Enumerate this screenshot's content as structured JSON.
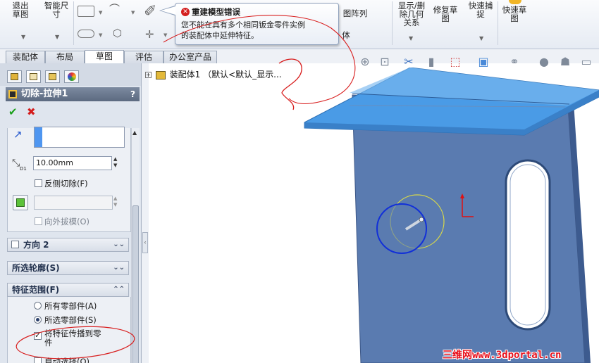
{
  "ribbon": {
    "exit_sketch": "退出草图",
    "smart_dim": "智能尺寸",
    "pattern_label": "图阵列",
    "body_label": "体",
    "display_delete": "显示/删除几何关系",
    "repair_sketch": "修复草图",
    "quick_snap": "快速捕捉",
    "rapid_sketch": "快速草图"
  },
  "tooltip": {
    "title": "重建模型错误",
    "line1": "您不能在具有多个相同钣金零件实例",
    "line2": "的装配体中延伸特征。"
  },
  "tabs": [
    {
      "label": "装配体"
    },
    {
      "label": "布局"
    },
    {
      "label": "草图"
    },
    {
      "label": "评估"
    },
    {
      "label": "办公室产品"
    }
  ],
  "property_manager": {
    "title": "切除-拉伸1",
    "help": "?",
    "ok": "✔",
    "cancel": "✖",
    "depth_value": "10.00mm",
    "depth_unit_badge": "D1",
    "flip_side": "反侧切除(F)",
    "draft_outward": "向外拔模(O)",
    "direction2": "方向 2",
    "selected_contours": "所选轮廓(S)",
    "feature_scope": "特征范围(F)",
    "all_components": "所有零部件(A)",
    "selected_components": "所选零部件(S)",
    "propagate_line1": "将特征传播到零",
    "propagate_line2": "件",
    "auto_select": "自动选择(O)"
  },
  "tree": {
    "root": "装配体1 （默认<默认_显示..."
  },
  "watermark": "三维网www.3dportal.cn",
  "colors": {
    "sheet_face": "#5a7bb0",
    "flange_top": "#4a9be6",
    "annotation_red": "#d81e1e",
    "circle_blue": "#1230d8",
    "circle_yellow": "#d8d84a"
  }
}
